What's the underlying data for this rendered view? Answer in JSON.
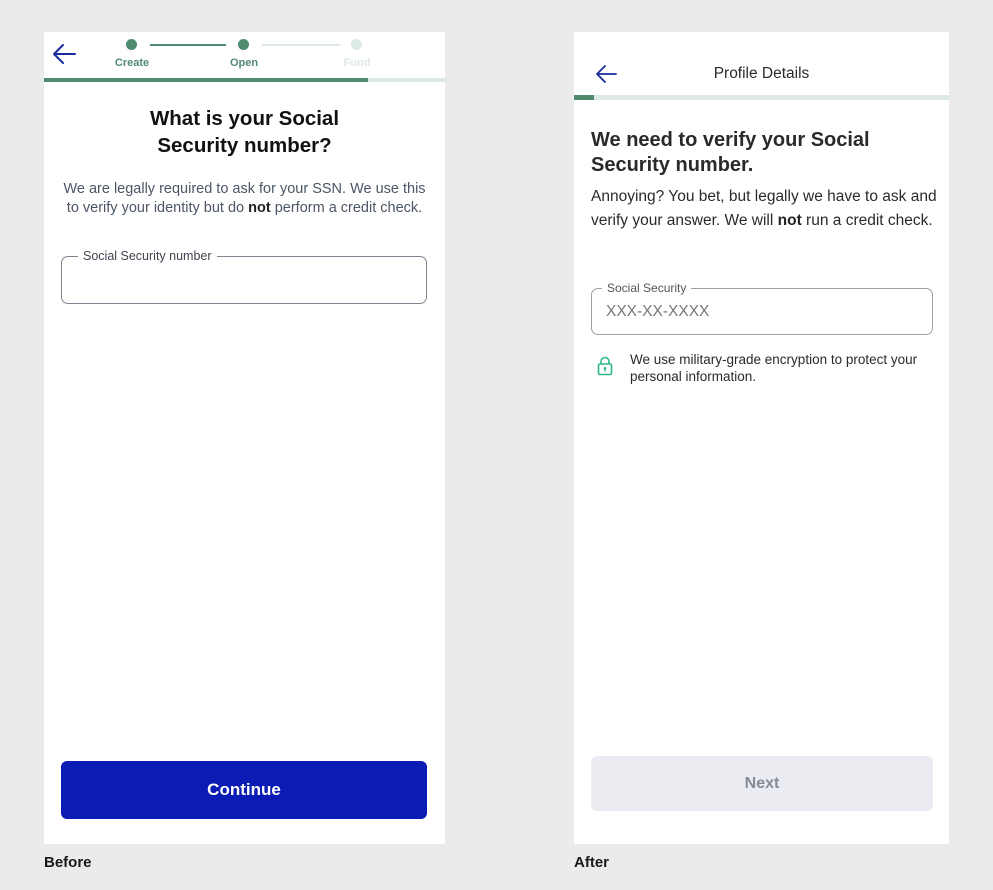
{
  "colors": {
    "accent_green": "#4f8a6f",
    "primary_blue": "#0a1cb3",
    "back_arrow_blue": "#1a2b9a",
    "disabled_button": "#eaecf1",
    "lock_icon_green": "#2bb58a"
  },
  "before": {
    "caption": "Before",
    "back_icon": "arrow-left-icon",
    "stepper": {
      "steps": [
        {
          "label": "Create",
          "state": "complete"
        },
        {
          "label": "Open",
          "state": "current"
        },
        {
          "label": "Fund",
          "state": "upcoming"
        }
      ]
    },
    "progress_fraction": 0.81,
    "title_line1": "What is your Social",
    "title_line2": "Security number?",
    "description": {
      "part1": "We are legally required to ask for your SSN. We use this to verify your identity but do ",
      "bold": "not",
      "part2": " perform a credit check."
    },
    "ssn_field": {
      "label": "Social Security number",
      "value": ""
    },
    "continue_label": "Continue"
  },
  "after": {
    "caption": "After",
    "back_icon": "arrow-left-icon",
    "header_title": "Profile Details",
    "progress_fraction": 0.05,
    "title": "We need to verify your Social Security number.",
    "description": {
      "part1": "Annoying? You bet, but legally we have to ask and verify your answer. We will ",
      "bold": "not",
      "part2": " run a credit check."
    },
    "ssn_field": {
      "label": "Social Security",
      "placeholder": "XXX-XX-XXXX",
      "value": ""
    },
    "secure_icon": "lock-icon",
    "secure_note": "We use military-grade encryption to protect your personal information.",
    "next_label": "Next",
    "next_enabled": false
  }
}
